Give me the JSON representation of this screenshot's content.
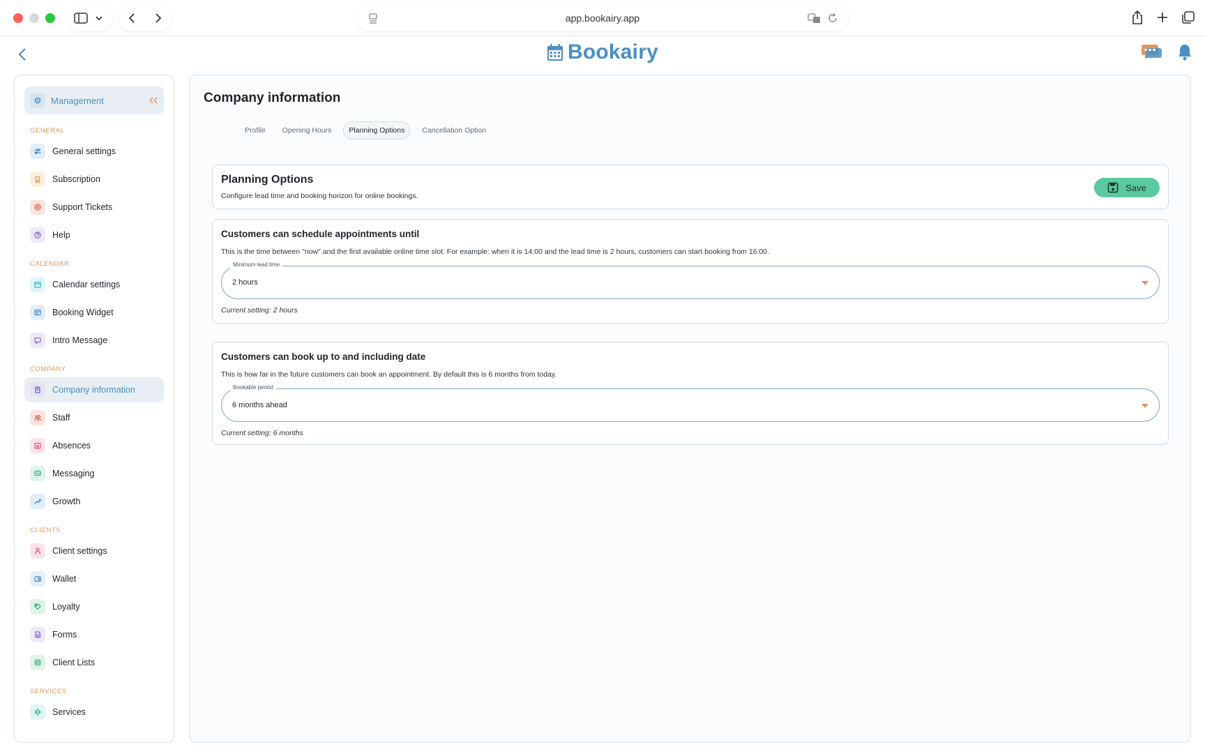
{
  "browser": {
    "url": "app.bookairy.app"
  },
  "header": {
    "logo_text": "Bookairy"
  },
  "sidebar": {
    "management_label": "Management",
    "sections": [
      {
        "label": "GENERAL",
        "items": [
          {
            "label": "General settings",
            "icon": "sliders-icon",
            "color": "#4a8fc4",
            "bg": "#e3eef8"
          },
          {
            "label": "Subscription",
            "icon": "award-icon",
            "color": "#e0955d",
            "bg": "#fbeede"
          },
          {
            "label": "Support Tickets",
            "icon": "lifebuoy-icon",
            "color": "#e0604f",
            "bg": "#fbe4e0"
          },
          {
            "label": "Help",
            "icon": "question-icon",
            "color": "#8b6cd0",
            "bg": "#eee8f9"
          }
        ]
      },
      {
        "label": "CALENDAR",
        "items": [
          {
            "label": "Calendar settings",
            "icon": "calendar-icon",
            "color": "#3fb3c9",
            "bg": "#e1f4f7"
          },
          {
            "label": "Booking Widget",
            "icon": "widget-icon",
            "color": "#4a8fc4",
            "bg": "#e3eef8"
          },
          {
            "label": "Intro Message",
            "icon": "message-icon",
            "color": "#8b6cd0",
            "bg": "#eee8f9"
          }
        ]
      },
      {
        "label": "COMPANY",
        "items": [
          {
            "label": "Company information",
            "icon": "building-icon",
            "color": "#6b5fd3",
            "bg": "#e6e3f8",
            "active": true
          },
          {
            "label": "Staff",
            "icon": "users-icon",
            "color": "#e0604f",
            "bg": "#fbe4e0"
          },
          {
            "label": "Absences",
            "icon": "calendar-x-icon",
            "color": "#e05a86",
            "bg": "#fbe3ec"
          },
          {
            "label": "Messaging",
            "icon": "chat-icon",
            "color": "#3fae7a",
            "bg": "#e0f3ea"
          },
          {
            "label": "Growth",
            "icon": "trending-icon",
            "color": "#3f8fc9",
            "bg": "#e1eef8"
          }
        ]
      },
      {
        "label": "CLIENTS",
        "items": [
          {
            "label": "Client settings",
            "icon": "user-icon",
            "color": "#e05a86",
            "bg": "#fbe3ec"
          },
          {
            "label": "Wallet",
            "icon": "wallet-icon",
            "color": "#4a8fc4",
            "bg": "#e3eef8"
          },
          {
            "label": "Loyalty",
            "icon": "tag-icon",
            "color": "#3fae7a",
            "bg": "#e0f3ea"
          },
          {
            "label": "Forms",
            "icon": "document-icon",
            "color": "#8b6cd0",
            "bg": "#eee8f9"
          },
          {
            "label": "Client Lists",
            "icon": "list-icon",
            "color": "#3fae7a",
            "bg": "#e0f3ea"
          }
        ]
      },
      {
        "label": "SERVICES",
        "items": [
          {
            "label": "Services",
            "icon": "diamond-icon",
            "color": "#3fb3a0",
            "bg": "#e0f4f0"
          }
        ]
      }
    ]
  },
  "main": {
    "title": "Company information",
    "tabs": [
      {
        "label": "Profile"
      },
      {
        "label": "Opening Hours"
      },
      {
        "label": "Planning Options",
        "active": true
      },
      {
        "label": "Cancellation Option"
      }
    ],
    "planning": {
      "title": "Planning Options",
      "subtitle": "Configure lead time and booking horizon for online bookings.",
      "save_label": "Save"
    },
    "lead_time": {
      "title": "Customers can schedule appointments until",
      "description": "This is the time between \"now\" and the first available online time slot. For example: when it is 14:00 and the lead time is 2 hours, customers can start booking from 16:00.",
      "field_label": "Minimum lead time",
      "value": "2 hours",
      "current": "Current setting: 2 hours"
    },
    "booking_period": {
      "title": "Customers can book up to and including date",
      "description": "This is how far in the future customers can book an appointment. By default this is 6 months from today.",
      "field_label": "Bookable period",
      "value": "6 months ahead",
      "current": "Current setting: 6 months"
    }
  },
  "colors": {
    "brand": "#4a8fc4",
    "accent": "#e0955d",
    "save": "#5bc8a0"
  }
}
